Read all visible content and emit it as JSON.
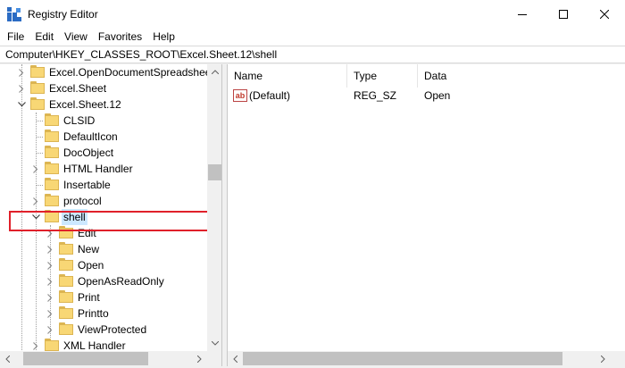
{
  "window": {
    "title": "Registry Editor"
  },
  "menu": [
    "File",
    "Edit",
    "View",
    "Favorites",
    "Help"
  ],
  "address": {
    "value": "Computer\\HKEY_CLASSES_ROOT\\Excel.Sheet.12\\shell"
  },
  "tree": {
    "items": [
      {
        "label": "Excel.OpenDocumentSpreadsheet",
        "level": 1,
        "expander": "collapsed"
      },
      {
        "label": "Excel.Sheet",
        "level": 1,
        "expander": "collapsed"
      },
      {
        "label": "Excel.Sheet.12",
        "level": 1,
        "expander": "expanded"
      },
      {
        "label": "CLSID",
        "level": 2,
        "expander": "none"
      },
      {
        "label": "DefaultIcon",
        "level": 2,
        "expander": "none"
      },
      {
        "label": "DocObject",
        "level": 2,
        "expander": "none"
      },
      {
        "label": "HTML Handler",
        "level": 2,
        "expander": "collapsed"
      },
      {
        "label": "Insertable",
        "level": 2,
        "expander": "none"
      },
      {
        "label": "protocol",
        "level": 2,
        "expander": "collapsed"
      },
      {
        "label": "shell",
        "level": 2,
        "expander": "expanded",
        "selected": true
      },
      {
        "label": "Edit",
        "level": 3,
        "expander": "collapsed"
      },
      {
        "label": "New",
        "level": 3,
        "expander": "collapsed"
      },
      {
        "label": "Open",
        "level": 3,
        "expander": "collapsed"
      },
      {
        "label": "OpenAsReadOnly",
        "level": 3,
        "expander": "collapsed"
      },
      {
        "label": "Print",
        "level": 3,
        "expander": "collapsed"
      },
      {
        "label": "Printto",
        "level": 3,
        "expander": "collapsed"
      },
      {
        "label": "ViewProtected",
        "level": 3,
        "expander": "collapsed"
      },
      {
        "label": "XML Handler",
        "level": 2,
        "expander": "collapsed"
      }
    ]
  },
  "list": {
    "columns": [
      "Name",
      "Type",
      "Data"
    ],
    "rows": [
      {
        "name": "(Default)",
        "type": "REG_SZ",
        "data": "Open",
        "icon": "string-value-icon"
      }
    ]
  },
  "colors": {
    "selection": "#cce8ff",
    "highlight_box": "#e0202a",
    "folder": "#f8d775",
    "folder_border": "#dcb552"
  }
}
